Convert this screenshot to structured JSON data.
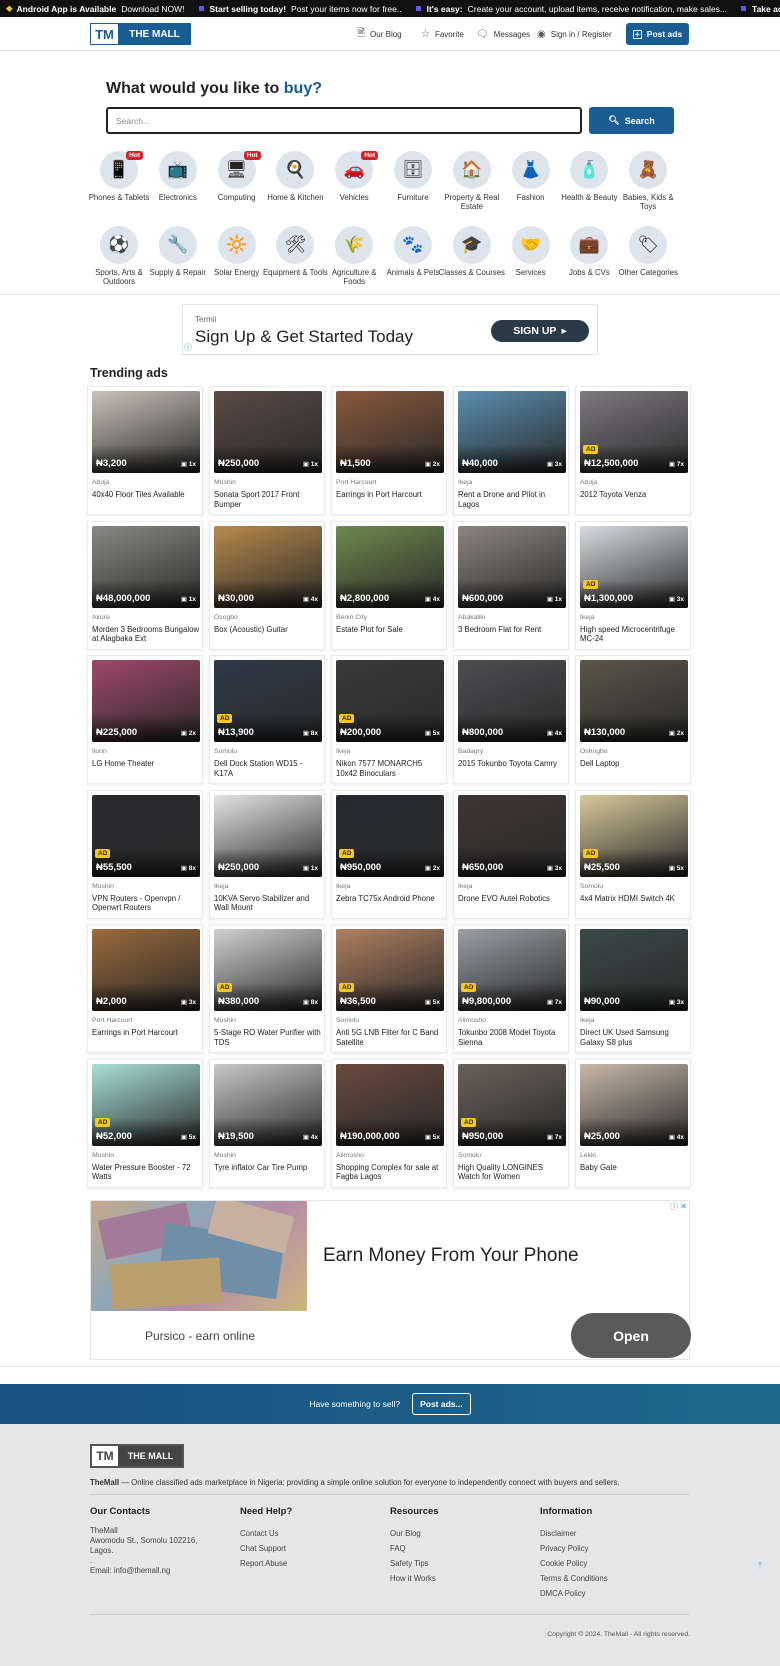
{
  "ticker": [
    {
      "bold": "Android App is Available",
      "text": "Download NOW!"
    },
    {
      "bold": "Start selling today!",
      "text": "Post your items now for free.."
    },
    {
      "bold": "It's easy:",
      "text": "Create your account, upload items, receive notification, make sales..."
    },
    {
      "bold": "Take adva",
      "text": ""
    }
  ],
  "header": {
    "logo_mark": "TM",
    "logo_text": "THE MALL",
    "nav": {
      "blog": "Our Blog",
      "favorite": "Favorite",
      "messages": "Messages",
      "signin": "Sign in / Register"
    },
    "post_ads": "Post ads"
  },
  "hero": {
    "title": "What would you like to",
    "title_accent": "buy?",
    "search_placeholder": "Search...",
    "search_button": "Search"
  },
  "categories": [
    {
      "label": "Phones & Tablets",
      "icon": "phone-icon",
      "hot": "Hot"
    },
    {
      "label": "Electronics",
      "icon": "tv-icon",
      "hot": ""
    },
    {
      "label": "Computing",
      "icon": "computer-icon",
      "hot": "Hot"
    },
    {
      "label": "Home & Kitchen",
      "icon": "kitchen-icon",
      "hot": ""
    },
    {
      "label": "Vehicles",
      "icon": "car-icon",
      "hot": "Hot"
    },
    {
      "label": "Furniture",
      "icon": "furniture-icon",
      "hot": ""
    },
    {
      "label": "Property & Real Estate",
      "icon": "house-icon",
      "hot": ""
    },
    {
      "label": "Fashion",
      "icon": "fashion-icon",
      "hot": ""
    },
    {
      "label": "Health & Beauty",
      "icon": "beauty-icon",
      "hot": ""
    },
    {
      "label": "Babies, Kids & Toys",
      "icon": "teddy-bear-icon",
      "hot": ""
    },
    {
      "label": "Sports, Arts & Outdoors",
      "icon": "sports-icon",
      "hot": ""
    },
    {
      "label": "Supply & Repair",
      "icon": "repair-icon",
      "hot": ""
    },
    {
      "label": "Solar Energy",
      "icon": "solar-panel-icon",
      "hot": ""
    },
    {
      "label": "Equipment & Tools",
      "icon": "tools-icon",
      "hot": ""
    },
    {
      "label": "Agriculture & Foods",
      "icon": "agriculture-icon",
      "hot": ""
    },
    {
      "label": "Animals & Pets",
      "icon": "pets-icon",
      "hot": ""
    },
    {
      "label": "Classes & Courses",
      "icon": "classes-icon",
      "hot": ""
    },
    {
      "label": "Services",
      "icon": "services-icon",
      "hot": ""
    },
    {
      "label": "Jobs & CVs",
      "icon": "briefcase-icon",
      "hot": ""
    },
    {
      "label": "Other Categories",
      "icon": "tag-icon",
      "hot": ""
    }
  ],
  "ad_top": {
    "advertiser": "Termii",
    "headline": "Sign Up & Get Started Today",
    "cta": "SIGN UP"
  },
  "trending": {
    "title": "Trending ads",
    "items": [
      {
        "price": "₦3,200",
        "count": "1x",
        "ad": "",
        "location": "Abuja",
        "title": "40x40 Floor Tiles Available",
        "color": "#c9c2b8"
      },
      {
        "price": "₦250,000",
        "count": "1x",
        "ad": "",
        "location": "Mushin",
        "title": "Sonata Sport 2017 Front Bumper",
        "color": "#5b4a44"
      },
      {
        "price": "₦1,500",
        "count": "2x",
        "ad": "",
        "location": "Port Harcourt",
        "title": "Earrings in Port Harcourt",
        "color": "#8a5a3c"
      },
      {
        "price": "₦40,000",
        "count": "3x",
        "ad": "",
        "location": "Ikeja",
        "title": "Rent a Drone and Pilot in Lagos",
        "color": "#5a8fb0"
      },
      {
        "price": "₦12,500,000",
        "count": "7x",
        "ad": "AD",
        "location": "Abuja",
        "title": "2012 Toyota Venza",
        "color": "#7e7a80"
      },
      {
        "price": "₦48,000,000",
        "count": "1x",
        "ad": "",
        "location": "Akure",
        "title": "Morden 3 Bedrooms Bungalow at Alagbaka Ext",
        "color": "#8a8a84"
      },
      {
        "price": "₦30,000",
        "count": "4x",
        "ad": "",
        "location": "Osogbo",
        "title": "Box (Acoustic) Guitar",
        "color": "#b88a4a"
      },
      {
        "price": "₦2,800,000",
        "count": "4x",
        "ad": "",
        "location": "Benin City",
        "title": "Estate Plot for Sale",
        "color": "#6e8a4e"
      },
      {
        "price": "₦600,000",
        "count": "1x",
        "ad": "",
        "location": "Abakaliki",
        "title": "3 Bedroom Flat for Rent",
        "color": "#8c8680"
      },
      {
        "price": "₦1,300,000",
        "count": "3x",
        "ad": "AD",
        "location": "Ikeja",
        "title": "High speed Microcentrifuge MC-24",
        "color": "#d8dbe0"
      },
      {
        "price": "₦225,000",
        "count": "2x",
        "ad": "",
        "location": "Ilorin",
        "title": "LG Home Theater",
        "color": "#a0486a"
      },
      {
        "price": "₦13,900",
        "count": "8x",
        "ad": "AD",
        "location": "Somolu",
        "title": "Dell Dock Station WD15 - K17A",
        "color": "#2e3a4a"
      },
      {
        "price": "₦200,000",
        "count": "5x",
        "ad": "AD",
        "location": "Ikeja",
        "title": "Nikon 7577 MONARCH5 10x42 Binoculars",
        "color": "#3a3a3a"
      },
      {
        "price": "₦800,000",
        "count": "4x",
        "ad": "",
        "location": "Badagry",
        "title": "2015 Tokunbo Toyota Camry",
        "color": "#4e4e52"
      },
      {
        "price": "₦130,000",
        "count": "2x",
        "ad": "",
        "location": "Oshogbo",
        "title": "Dell Laptop",
        "color": "#5a5648"
      },
      {
        "price": "₦55,500",
        "count": "8x",
        "ad": "AD",
        "location": "Mushin",
        "title": "VPN Routers - Openvpn / Openwrt Routers",
        "color": "#2a2a2e"
      },
      {
        "price": "₦250,000",
        "count": "1x",
        "ad": "",
        "location": "Ikeja",
        "title": "10KVA Servo Stabilizer and Wall Mount",
        "color": "#e4e4e4"
      },
      {
        "price": "₦950,000",
        "count": "2x",
        "ad": "AD",
        "location": "Ikeja",
        "title": "Zebra TC75x Android Phone",
        "color": "#262a30"
      },
      {
        "price": "₦650,000",
        "count": "3x",
        "ad": "",
        "location": "Ikeja",
        "title": "Drone EVO Autel Robotics",
        "color": "#3e3634"
      },
      {
        "price": "₦25,500",
        "count": "5x",
        "ad": "AD",
        "location": "Somolu",
        "title": "4x4 Matrix HDMI Switch 4K",
        "color": "#d8c89a"
      },
      {
        "price": "₦2,000",
        "count": "3x",
        "ad": "",
        "location": "Port Harcourt",
        "title": "Earrings in Port Harcourt",
        "color": "#9a6a3a"
      },
      {
        "price": "₦380,000",
        "count": "8x",
        "ad": "AD",
        "location": "Mushin",
        "title": "5-Stage RO Water Purifier with TDS",
        "color": "#d0d0d0"
      },
      {
        "price": "₦36,500",
        "count": "5x",
        "ad": "AD",
        "location": "Somolu",
        "title": "Anti 5G LNB Filter for C Band Satellite",
        "color": "#b08060"
      },
      {
        "price": "₦9,800,000",
        "count": "7x",
        "ad": "AD",
        "location": "Alimosho",
        "title": "Tokunbo 2008 Model Toyota Sienna",
        "color": "#9a9ea4"
      },
      {
        "price": "₦90,000",
        "count": "3x",
        "ad": "",
        "location": "Ikeja",
        "title": "Direct UK Used Samsung Galaxy S8 plus",
        "color": "#3a4a48"
      },
      {
        "price": "₦52,000",
        "count": "5x",
        "ad": "AD",
        "location": "Mushin",
        "title": "Water Pressure Booster - 72 Watts",
        "color": "#a8e0d8"
      },
      {
        "price": "₦19,500",
        "count": "4x",
        "ad": "",
        "location": "Mushin",
        "title": "Tyre inflator Car Tire Pump",
        "color": "#c8c8c8"
      },
      {
        "price": "₦190,000,000",
        "count": "5x",
        "ad": "",
        "location": "Alimosho",
        "title": "Shopping Complex for sale at Fagba Lagos",
        "color": "#6a4a3e"
      },
      {
        "price": "₦950,000",
        "count": "7x",
        "ad": "AD",
        "location": "Somolu",
        "title": "High Quality LONGINES Watch for Women",
        "color": "#6a6258"
      },
      {
        "price": "₦25,000",
        "count": "4x",
        "ad": "",
        "location": "Lekki",
        "title": "Baby Gate",
        "color": "#c8b8a8"
      }
    ]
  },
  "ad_bottom": {
    "headline": "Earn Money From Your Phone",
    "advertiser": "Pursico - earn online",
    "cta": "Open"
  },
  "sell_banner": {
    "text": "Have something to sell?",
    "button": "Post ads..."
  },
  "footer": {
    "logo_mark": "TM",
    "logo_text": "THE MALL",
    "brand": "TheMall",
    "description": "— Online classified ads marketplace in Nigeria; providing a simple online solution for everyone to independently connect with buyers and sellers.",
    "contacts": {
      "title": "Our Contacts",
      "name": "TheMall",
      "address1": "Awomodu St., Somolu 102216,",
      "address2": "Lagos.",
      "dot": ".",
      "email": "Email: info@themall.ng"
    },
    "help": {
      "title": "Need Help?",
      "items": [
        "Contact Us",
        "Chat Support",
        "Report Abuse"
      ]
    },
    "resources": {
      "title": "Resources",
      "items": [
        "Our Blog",
        "FAQ",
        "Safety Tips",
        "How it Works"
      ]
    },
    "information": {
      "title": "Information",
      "items": [
        "Disclaimer",
        "Privacy Policy",
        "Cookie Policy",
        "Terms & Conditions",
        "DMCA Policy"
      ]
    },
    "copyright": "Copyright © 2024. TheMall - All rights reserved."
  },
  "colors": {
    "brand": "#1a5c94",
    "hot": "#d0232b",
    "ad_badge": "#f4c91c"
  }
}
